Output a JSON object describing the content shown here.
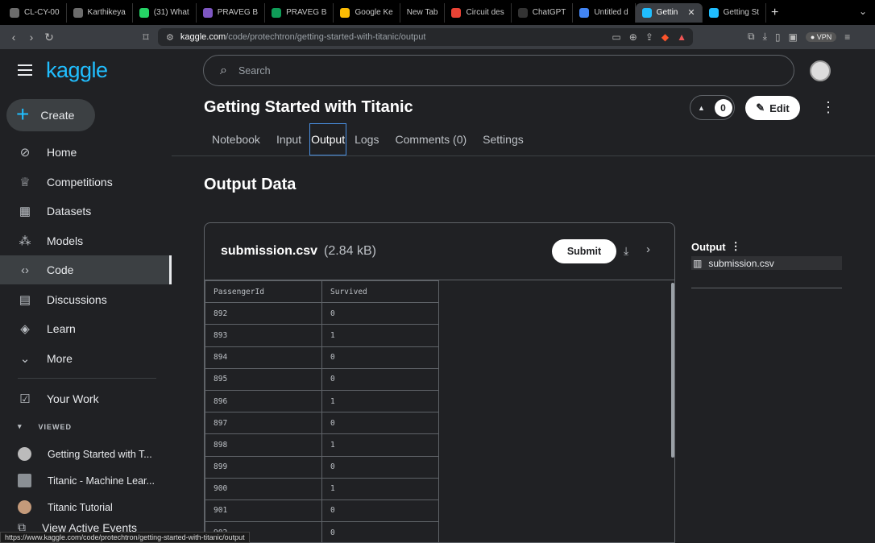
{
  "browser": {
    "tabs": [
      {
        "label": "CL-CY-00",
        "icon": "avatar-icon",
        "color": "#6c6c6c"
      },
      {
        "label": "Karthikeya",
        "icon": "avatar-icon",
        "color": "#6c6c6c"
      },
      {
        "label": "(31) What",
        "icon": "whatsapp-icon",
        "color": "#25d366"
      },
      {
        "label": "PRAVEG B",
        "icon": "forms-icon",
        "color": "#7e57c2"
      },
      {
        "label": "PRAVEG B",
        "icon": "sheets-icon",
        "color": "#0f9d58"
      },
      {
        "label": "Google Ke",
        "icon": "keep-icon",
        "color": "#fbbc04"
      },
      {
        "label": "New Tab",
        "icon": "",
        "color": ""
      },
      {
        "label": "Circuit des",
        "icon": "grid-icon",
        "color": "#ea4335"
      },
      {
        "label": "ChatGPT",
        "icon": "chatgpt-icon",
        "color": "#333"
      },
      {
        "label": "Untitled d",
        "icon": "docs-icon",
        "color": "#4285f4"
      },
      {
        "label": "Gettin",
        "icon": "kaggle-icon",
        "color": "#20beff",
        "active": true
      },
      {
        "label": "Getting St",
        "icon": "kaggle-icon",
        "color": "#20beff"
      }
    ],
    "url_domain": "kaggle.com",
    "url_path": "/code/protechtron/getting-started-with-titanic/output",
    "vpn_label": "VPN",
    "status_url": "https://www.kaggle.com/code/protechtron/getting-started-with-titanic/output"
  },
  "sidebar": {
    "logo": "kaggle",
    "create_label": "Create",
    "items": [
      {
        "label": "Home",
        "icon": "compass-icon"
      },
      {
        "label": "Competitions",
        "icon": "trophy-icon"
      },
      {
        "label": "Datasets",
        "icon": "table-icon"
      },
      {
        "label": "Models",
        "icon": "models-icon"
      },
      {
        "label": "Code",
        "icon": "code-icon",
        "active": true
      },
      {
        "label": "Discussions",
        "icon": "discussion-icon"
      },
      {
        "label": "Learn",
        "icon": "graduation-icon"
      },
      {
        "label": "More",
        "icon": "chevron-down-icon"
      }
    ],
    "your_work": "Your Work",
    "viewed_header": "VIEWED",
    "recent": [
      {
        "label": "Getting Started with T..."
      },
      {
        "label": "Titanic - Machine Lear..."
      },
      {
        "label": "Titanic Tutorial"
      }
    ],
    "view_active": "View Active Events"
  },
  "header": {
    "search_placeholder": "Search",
    "title": "Getting Started with Titanic",
    "vote_count": "0",
    "edit_label": "Edit"
  },
  "tabs": [
    "Notebook",
    "Input",
    "Output",
    "Logs",
    "Comments (0)",
    "Settings"
  ],
  "active_tab": "Output",
  "main": {
    "section_title": "Output Data",
    "file_name": "submission.csv",
    "file_size": "(2.84 kB)",
    "submit_label": "Submit",
    "columns": [
      "PassengerId",
      "Survived"
    ],
    "rows": [
      [
        "892",
        "0"
      ],
      [
        "893",
        "1"
      ],
      [
        "894",
        "0"
      ],
      [
        "895",
        "0"
      ],
      [
        "896",
        "1"
      ],
      [
        "897",
        "0"
      ],
      [
        "898",
        "1"
      ],
      [
        "899",
        "0"
      ],
      [
        "900",
        "1"
      ],
      [
        "901",
        "0"
      ],
      [
        "902",
        "0"
      ]
    ]
  },
  "side_panel": {
    "title": "Output",
    "file": "submission.csv"
  },
  "colors": {
    "accent": "#20beff",
    "background": "#202124"
  }
}
